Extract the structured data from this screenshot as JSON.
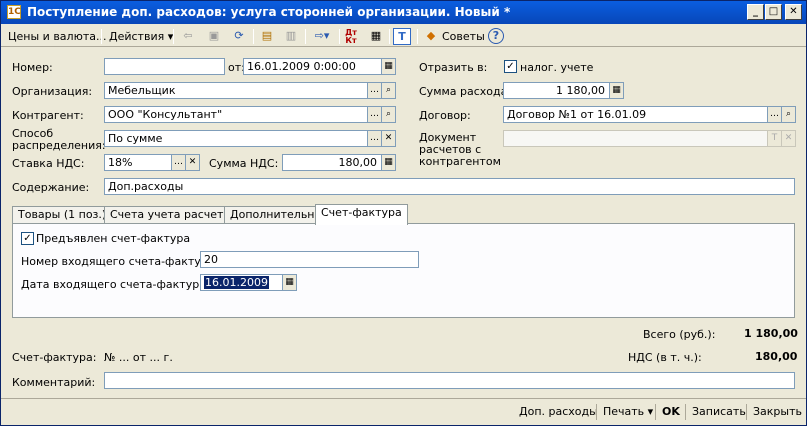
{
  "window": {
    "title": "Поступление доп. расходов: услуга сторонней организации. Новый *",
    "icon": "1C"
  },
  "titlebar_buttons": {
    "minimize": "_",
    "maximize": "□",
    "close": "✕"
  },
  "toolbar": {
    "prices_currency": "Цены и валюта...",
    "actions": "Действия ▾",
    "dt_kt": "Дт Кт",
    "tips": "Советы",
    "help": "?"
  },
  "form": {
    "number_label": "Номер:",
    "number_value": "",
    "from_label": "от:",
    "date_value": "16.01.2009  0:00:00",
    "reflect_label": "Отразить в:",
    "tax_accounting_label": "налог. учете",
    "tax_accounting_checked": true,
    "organization_label": "Организация:",
    "organization_value": "Мебельщик",
    "expense_sum_label": "Сумма расхода:",
    "expense_sum_value": "1 180,00",
    "counterparty_label": "Контрагент:",
    "counterparty_value": "ООО \"Консультант\"",
    "contract_label": "Договор:",
    "contract_value": "Договор №1 от 16.01.09",
    "distribution_label_1": "Способ",
    "distribution_label_2": "распределения:",
    "distribution_value": "По сумме",
    "settlement_doc_label_1": "Документ",
    "settlement_doc_label_2": "расчетов с",
    "settlement_doc_label_3": "контрагентом",
    "settlement_doc_value": "",
    "vat_rate_label": "Ставка НДС:",
    "vat_rate_value": "18%",
    "vat_sum_label": "Сумма НДС:",
    "vat_sum_value": "180,00",
    "content_label": "Содержание:",
    "content_value": "Доп.расходы"
  },
  "tabs": [
    {
      "label": "Товары (1 поз.)"
    },
    {
      "label": "Счета учета расчетов"
    },
    {
      "label": "Дополнительно"
    },
    {
      "label": "Счет-фактура"
    }
  ],
  "invoice_tab": {
    "presented_label": "Предъявлен счет-фактура",
    "presented_checked": true,
    "incoming_number_label": "Номер входящего счета-фактуры:",
    "incoming_number_value": "20",
    "incoming_date_label": "Дата входящего счета-фактуры:",
    "incoming_date_value": "16.01.2009"
  },
  "totals": {
    "total_label": "Всего (руб.):",
    "total_value": "1 180,00",
    "vat_included_label": "НДС (в т. ч.):",
    "vat_included_value": "180,00"
  },
  "invoice_footer": {
    "label": "Счет-фактура:",
    "value": "№  ...  от  ...  г."
  },
  "comment": {
    "label": "Комментарий:",
    "value": ""
  },
  "bottom_buttons": {
    "additional_expenses": "Доп. расходы",
    "print": "Печать ▾",
    "ok": "OK",
    "save": "Записать",
    "close": "Закрыть"
  }
}
